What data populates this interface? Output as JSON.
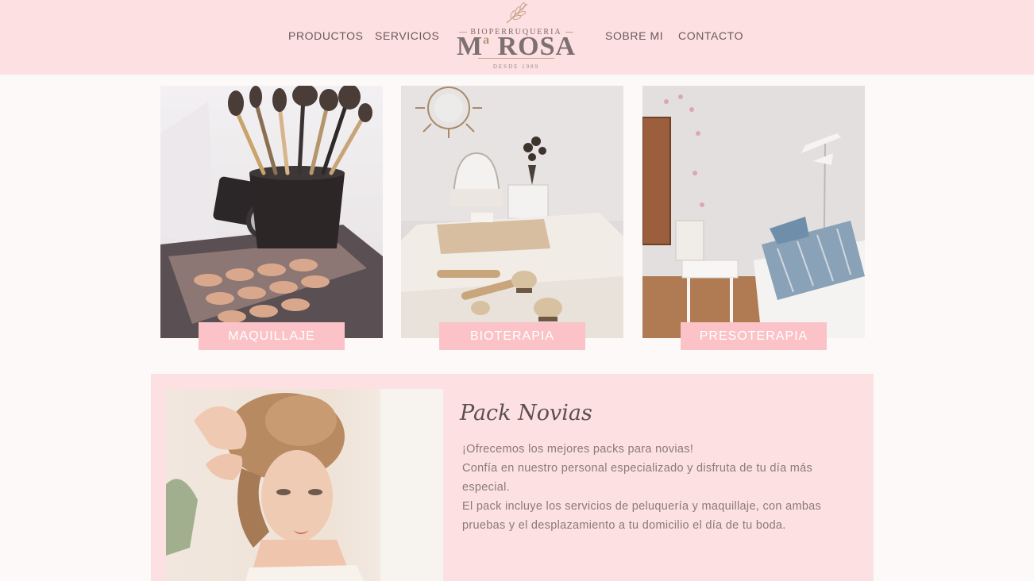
{
  "nav": {
    "productos": "PRODUCTOS",
    "servicios": "SERVICIOS",
    "sobre_mi": "SOBRE MI",
    "contacto": "CONTACTO"
  },
  "logo": {
    "top_text": "BIOPERRUQUERIA",
    "main_text": "M",
    "main_sup": "a",
    "main_rest": "ROSA",
    "tagline": "DESDE 1989"
  },
  "services": [
    {
      "label": "MAQUILLAJE",
      "image": "makeup-brushes-image"
    },
    {
      "label": "BIOTERAPIA",
      "image": "bioterapia-room-image"
    },
    {
      "label": "PRESOTERAPIA",
      "image": "presoterapia-room-image"
    }
  ],
  "pack": {
    "title": "Pack Novias",
    "lines": [
      "¡Ofrecemos los mejores packs para novias!",
      "Confía en nuestro personal especializado y disfruta de tu día más especial.",
      "El pack incluye los servicios de peluquería y maquillaje, con ambas pruebas y el desplazamiento a tu domicilio el día de tu boda."
    ],
    "image": "bride-hairstyle-image"
  },
  "colors": {
    "header_bg": "#fde0e2",
    "page_bg": "#fdf9f8",
    "label_bg": "#fbc3c7",
    "text_dark": "#6a5a59",
    "text_muted": "#8a7a78"
  }
}
